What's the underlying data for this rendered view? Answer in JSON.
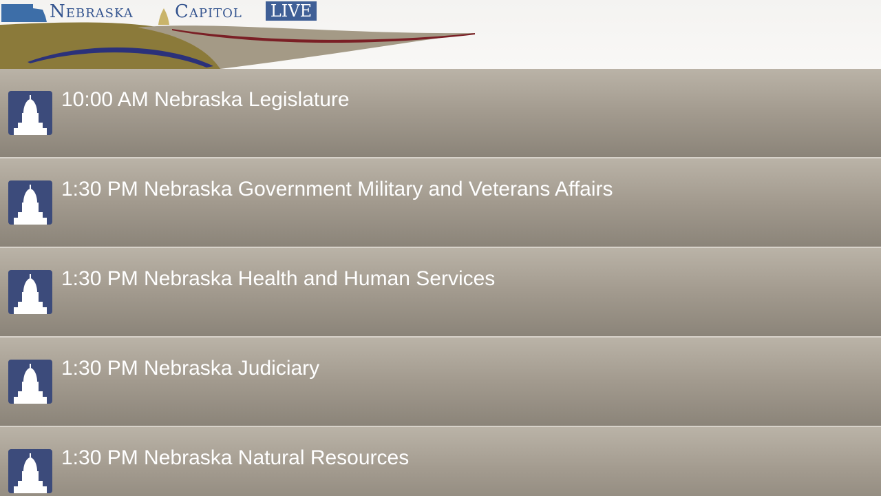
{
  "header": {
    "logo_word1": "Nebraska",
    "logo_word2": "Capitol",
    "logo_badge": "LIVE",
    "colors": {
      "logo_blue": "#34548f",
      "badge_blue": "#3f5f96",
      "gold": "#8b7a3a",
      "maroon": "#7a1f25",
      "navy": "#2b317a"
    }
  },
  "list": {
    "items": [
      {
        "label": "10:00 AM Nebraska Legislature",
        "icon": "capitol-icon"
      },
      {
        "label": "1:30 PM Nebraska Government Military and Veterans Affairs",
        "icon": "capitol-icon"
      },
      {
        "label": "1:30 PM Nebraska Health and Human Services",
        "icon": "capitol-icon"
      },
      {
        "label": "1:30 PM Nebraska Judiciary",
        "icon": "capitol-icon"
      },
      {
        "label": "1:30 PM Nebraska Natural Resources",
        "icon": "capitol-icon"
      }
    ]
  }
}
